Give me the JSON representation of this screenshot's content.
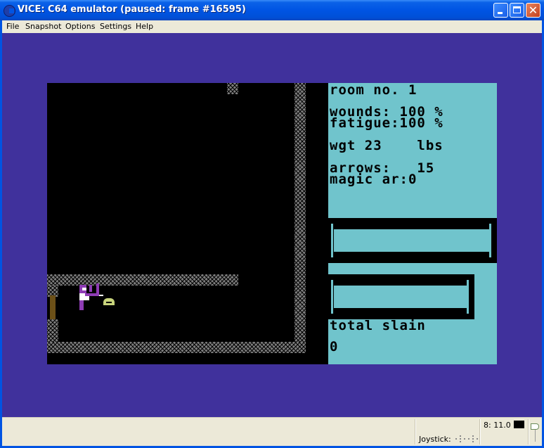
{
  "window": {
    "title": "VICE: C64 emulator (paused: frame #16595)",
    "controls": [
      "minimize",
      "maximize",
      "close"
    ]
  },
  "menu": {
    "items": [
      {
        "label": "File"
      },
      {
        "label": "Snapshot"
      },
      {
        "label": "Options"
      },
      {
        "label": "Settings"
      },
      {
        "label": "Help"
      }
    ]
  },
  "game": {
    "colors": {
      "border": "#40319c",
      "background": "#000000",
      "wall": "#7c7c7c",
      "sidebar": "#70c4cc",
      "player": "#8e3cb4",
      "item": "#c8d47c",
      "door": "#6c5018"
    },
    "stats": {
      "room": "room no. 1",
      "wounds": "wounds: 100 %",
      "fatigue": "fatigue:100 %",
      "weight": "wgt 23    lbs",
      "arrows": "arrows:   15",
      "magic_arrows": "magic ar:0",
      "total_slain_label": "total slain",
      "total_slain_value": "0"
    }
  },
  "statusbar": {
    "drive_status": "8: 11.0",
    "joystick_label": "Joystick:"
  }
}
